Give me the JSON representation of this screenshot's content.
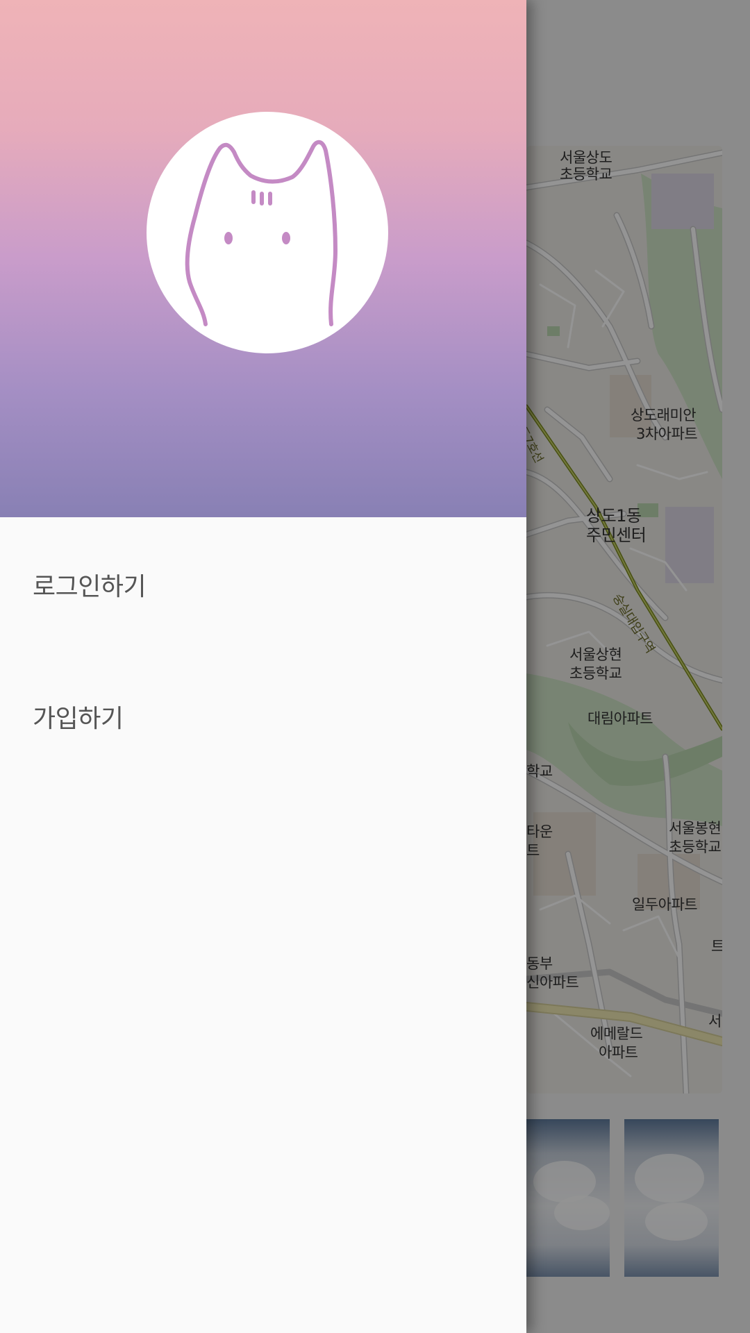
{
  "drawer": {
    "menu": [
      {
        "label": "로그인하기"
      },
      {
        "label": "가입하기"
      }
    ],
    "colors": {
      "header_top": "#efb3b7",
      "header_bottom": "#8880b4",
      "avatar_line": "#c48ac4"
    },
    "avatar_icon": "cat-icon"
  },
  "map": {
    "labels": [
      "서울상도",
      "초등학교",
      "상도래미안",
      "3차아파트",
      "상도1동",
      "주민센터",
      "숭실대입구역",
      "서울상현",
      "초등학교",
      "대림아파트",
      "학교",
      "타운",
      "트",
      "서울봉현",
      "초등학교",
      "일두아파트",
      "동부",
      "신아파트",
      "에메랄드",
      "아파트",
      "서",
      "트",
      "도7호선"
    ]
  }
}
